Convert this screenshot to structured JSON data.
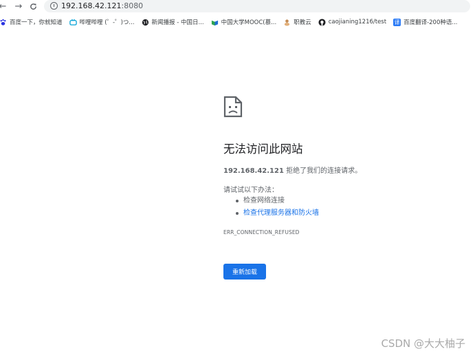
{
  "browser": {
    "url_host": "192.168.42.121",
    "url_port": ":8080",
    "back_icon": "arrow-left-icon",
    "forward_icon": "arrow-right-icon",
    "reload_icon": "reload-icon"
  },
  "bookmarks": [
    {
      "label": "百度一下，你就知道",
      "icon": "paw-icon",
      "color": "#2932e1"
    },
    {
      "label": "哔哩哔哩 (゜-゜)つ...",
      "icon": "bilibili-icon",
      "color": "#00a1d6"
    },
    {
      "label": "新闻播报 - 中国日...",
      "icon": "globe-icon",
      "color": "#202124"
    },
    {
      "label": "中国大学MOOC(慕...",
      "icon": "mooc-icon",
      "color": "#2ea44f"
    },
    {
      "label": "职教云",
      "icon": "zhijiaoyun-icon",
      "color": "#c48c55"
    },
    {
      "label": "caojianing1216/test",
      "icon": "github-icon",
      "color": "#202124"
    },
    {
      "label": "百度翻译-200种语...",
      "icon": "translate-icon",
      "color": "#2b7bf6"
    }
  ],
  "error": {
    "icon": "sad-page-icon",
    "title": "无法访问此网站",
    "host": "192.168.42.121",
    "message": " 拒绝了我们的连接请求。",
    "try_label": "请试试以下办法：",
    "suggestions": [
      "检查网络连接",
      "检查代理服务器和防火墙"
    ],
    "code": "ERR_CONNECTION_REFUSED",
    "reload_label": "重新加载"
  },
  "watermark": "CSDN @大大柚子",
  "colors": {
    "accent": "#1a73e8",
    "text": "#202124",
    "secondary": "#5f6368"
  }
}
